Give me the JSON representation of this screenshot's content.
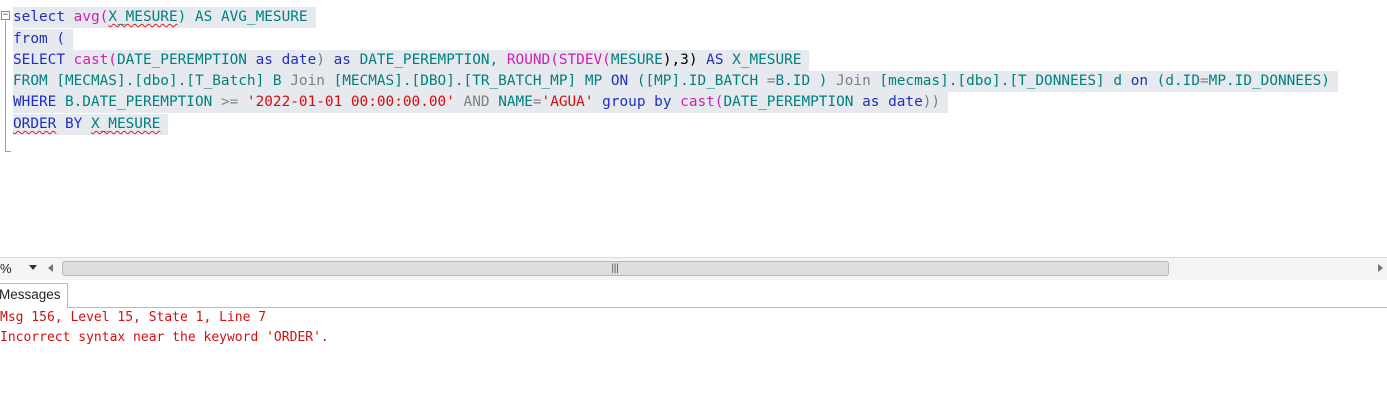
{
  "editor": {
    "line1": {
      "t1": "select ",
      "t2": "avg(",
      "t3": "X_MESURE",
      "t4": ") AS AVG_MESURE"
    },
    "line2": {
      "t1": "from ("
    },
    "line3": {
      "t1": "SELECT ",
      "t2": "cast(",
      "t3": "DATE_PEREMPTION",
      "t4": " as ",
      "t5": "date",
      "t6": ") ",
      "t7": "as",
      "t8": " DATE_PEREMPTION, ",
      "t9": "ROUND(STDEV(",
      "t10": "MESURE",
      "t11": "),3) ",
      "t12": "AS",
      "t13": " X_MESURE"
    },
    "line4": {
      "t1": "FROM [MECMAS].[dbo].[T_Batch] B ",
      "t2": "Join",
      "t3": " [MECMAS].[DBO].[TR_BATCH_MP] MP ",
      "t4": "ON",
      "t5": " ([MP].ID_BATCH ",
      "t6": "=",
      "t7": "B.ID ) ",
      "t8": "Join",
      "t9": " [mecmas].[dbo].[T_DONNEES] d ",
      "t10": "on",
      "t11": " (d.ID",
      "t12": "=",
      "t13": "MP.ID_DONNEES)"
    },
    "line5": {
      "t1": "WHERE ",
      "t2": "B.DATE_PEREMPTION ",
      "t3": ">=",
      "t4": " '2022-01-01 00:00:00.00'",
      "t5": " AND ",
      "t6": "NAME",
      "t7": "=",
      "t8": "'AGUA'",
      "t9": " group by ",
      "t10": "cast(",
      "t11": "DATE_PEREMPTION",
      "t12": " as ",
      "t13": "date",
      "t14": "))"
    },
    "line6": {
      "t1": "ORDER",
      "t2": " BY ",
      "t3": "X_MESURE"
    }
  },
  "zoom": {
    "label": "%"
  },
  "results": {
    "tab_label": "Messages",
    "lines": [
      "Msg 156, Level 15, State 1, Line 7",
      "Incorrect syntax near the keyword 'ORDER'."
    ]
  },
  "colors": {
    "keyword": "#1f2fbf",
    "function": "#d11fb3",
    "identifier": "#008080",
    "string": "#d20e0e",
    "operator": "#808080",
    "error": "#d11010",
    "selection": "#e6e9ee"
  },
  "icons": {
    "fold": "collapse-box-icon",
    "zoom_dropdown": "chevron-down-icon",
    "scroll_left": "arrow-left-icon",
    "scroll_right": "arrow-right-icon",
    "scroll_grip": "grip-icon"
  }
}
